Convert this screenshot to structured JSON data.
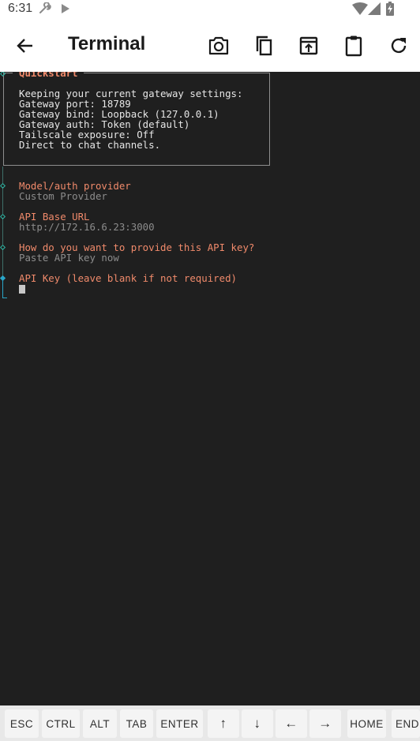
{
  "status_bar": {
    "time": "6:31"
  },
  "app_bar": {
    "title": "Terminal",
    "back_icon": "arrow-back-icon",
    "actions": [
      "camera-icon",
      "copy-icon",
      "open-in-new-icon",
      "clipboard-icon",
      "refresh-icon"
    ]
  },
  "terminal": {
    "box_title": "Quickstart",
    "box_lines": [
      "Keeping your current gateway settings:",
      "Gateway port: 18789",
      "Gateway bind: Loopback (127.0.0.1)",
      "Gateway auth: Token (default)",
      "Tailscale exposure: Off",
      "Direct to chat channels."
    ],
    "steps": [
      {
        "prompt": "Model/auth provider",
        "answer": "Custom Provider"
      },
      {
        "prompt": "API Base URL",
        "answer": "http://172.16.6.23:3000"
      },
      {
        "prompt": "How do you want to provide this API key?",
        "answer": "Paste API key now"
      },
      {
        "prompt": "API Key (leave blank if not required)",
        "answer": ""
      }
    ]
  },
  "extra_keys": [
    "ESC",
    "CTRL",
    "ALT",
    "TAB",
    "ENTER",
    "↑",
    "↓",
    "←",
    "→",
    "HOME",
    "END"
  ]
}
